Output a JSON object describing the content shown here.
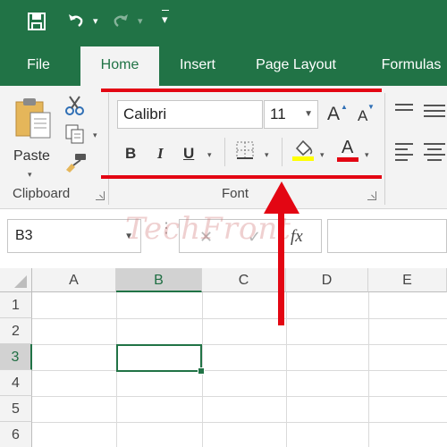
{
  "quick_access": {
    "save_icon": "save-icon",
    "undo_icon": "undo-icon",
    "redo_icon": "redo-icon",
    "customize_icon": "customize-qat-icon"
  },
  "tabs": [
    {
      "label": "File"
    },
    {
      "label": "Home"
    },
    {
      "label": "Insert"
    },
    {
      "label": "Page Layout"
    },
    {
      "label": "Formulas"
    }
  ],
  "clipboard": {
    "paste_label": "Paste",
    "group_label": "Clipboard"
  },
  "font": {
    "font_name": "Calibri",
    "font_size": "11",
    "bold": "B",
    "italic": "I",
    "underline": "U",
    "font_color_glyph": "A",
    "grow_glyph": "A",
    "shrink_glyph": "A",
    "group_label": "Font"
  },
  "formula_bar": {
    "name_box": "B3",
    "fx_label": "fx",
    "watermark": "TechFront"
  },
  "grid": {
    "columns": [
      "A",
      "B",
      "C",
      "D",
      "E"
    ],
    "rows": [
      "1",
      "2",
      "3",
      "4",
      "5",
      "6"
    ],
    "selected_cell": "B3"
  },
  "colors": {
    "accent": "#217346",
    "highlight_line": "#e30613",
    "fill_yellow": "#ffff00",
    "font_red": "#e30613"
  }
}
